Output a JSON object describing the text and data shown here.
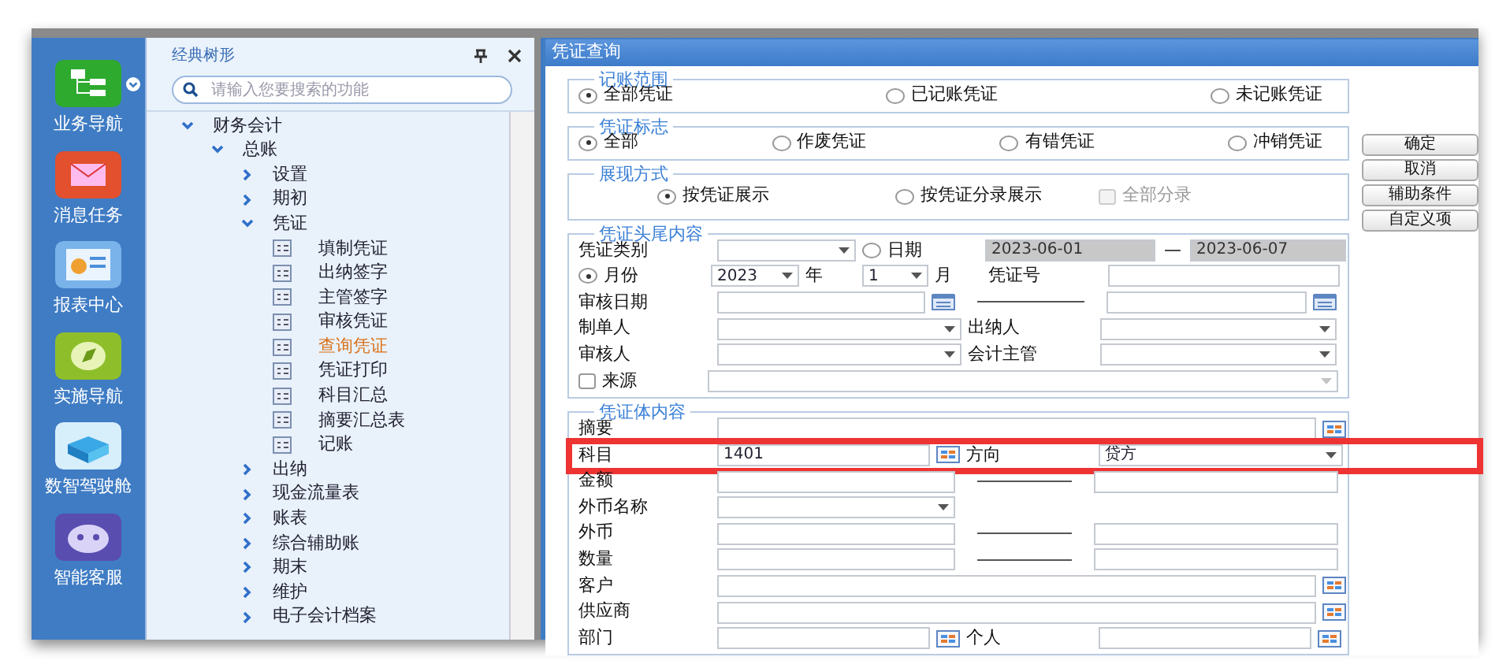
{
  "nav": [
    {
      "label": "业务导航",
      "dropdown": true
    },
    {
      "label": "消息任务",
      "dropdown": false
    },
    {
      "label": "报表中心",
      "dropdown": false
    },
    {
      "label": "实施导航",
      "dropdown": false
    },
    {
      "label": "数智驾驶舱",
      "dropdown": false
    },
    {
      "label": "智能客服",
      "dropdown": false
    }
  ],
  "tree_panel": {
    "title": "经典树形",
    "search": {
      "placeholder": "请输入您要搜索的功能"
    },
    "items": [
      {
        "label": "财务会计",
        "kind": "folder",
        "expanded": true,
        "selected": false,
        "children": [
          {
            "label": "总账",
            "kind": "folder",
            "expanded": true,
            "selected": false,
            "children": [
              {
                "label": "设置",
                "kind": "folder",
                "expanded": false,
                "selected": false
              },
              {
                "label": "期初",
                "kind": "folder",
                "expanded": false,
                "selected": false
              },
              {
                "label": "凭证",
                "kind": "folder",
                "expanded": true,
                "selected": false,
                "children": [
                  {
                    "label": "填制凭证",
                    "kind": "page",
                    "selected": false
                  },
                  {
                    "label": "出纳签字",
                    "kind": "page",
                    "selected": false
                  },
                  {
                    "label": "主管签字",
                    "kind": "page",
                    "selected": false
                  },
                  {
                    "label": "审核凭证",
                    "kind": "page",
                    "selected": false
                  },
                  {
                    "label": "查询凭证",
                    "kind": "page",
                    "selected": true
                  },
                  {
                    "label": "凭证打印",
                    "kind": "page",
                    "selected": false
                  },
                  {
                    "label": "科目汇总",
                    "kind": "page",
                    "selected": false
                  },
                  {
                    "label": "摘要汇总表",
                    "kind": "page",
                    "selected": false
                  },
                  {
                    "label": "记账",
                    "kind": "page",
                    "selected": false
                  }
                ]
              },
              {
                "label": "出纳",
                "kind": "folder",
                "expanded": false,
                "selected": false
              },
              {
                "label": "现金流量表",
                "kind": "folder",
                "expanded": false,
                "selected": false
              },
              {
                "label": "账表",
                "kind": "folder",
                "expanded": false,
                "selected": false
              },
              {
                "label": "综合辅助账",
                "kind": "folder",
                "expanded": false,
                "selected": false
              },
              {
                "label": "期末",
                "kind": "folder",
                "expanded": false,
                "selected": false
              },
              {
                "label": "维护",
                "kind": "folder",
                "expanded": false,
                "selected": false
              },
              {
                "label": "电子会计档案",
                "kind": "folder",
                "expanded": false,
                "selected": false
              }
            ]
          }
        ]
      }
    ]
  },
  "dialog": {
    "title": "凭证查询",
    "radio_groups": [
      {
        "legend": "记账范围",
        "options": [
          {
            "label": "全部凭证",
            "selected": true
          },
          {
            "label": "已记账凭证",
            "selected": false
          },
          {
            "label": "未记账凭证",
            "selected": false
          }
        ]
      },
      {
        "legend": "凭证标志",
        "options": [
          {
            "label": "全部",
            "selected": true
          },
          {
            "label": "作废凭证",
            "selected": false
          },
          {
            "label": "有错凭证",
            "selected": false
          },
          {
            "label": "冲销凭证",
            "selected": false
          }
        ]
      },
      {
        "legend": "展现方式",
        "options": [
          {
            "label": "按凭证展示",
            "selected": true
          },
          {
            "label": "按凭证分录展示",
            "selected": false
          }
        ],
        "checkbox": {
          "label": "全部分录",
          "checked": false,
          "disabled": true
        }
      }
    ],
    "sections": [
      {
        "legend": "凭证头尾内容",
        "rows": [
          {
            "items": [
              {
                "kind": "label",
                "text": "凭证类别"
              },
              {
                "kind": "select",
                "disabled": false
              },
              {
                "kind": "radio",
                "text": "日期",
                "selected": false
              },
              {
                "kind": "input",
                "value": "2023-06-01",
                "disabled": true
              },
              {
                "kind": "dash",
                "text": "—"
              },
              {
                "kind": "input",
                "value": "2023-06-07",
                "disabled": true
              }
            ]
          },
          {
            "items": [
              {
                "kind": "radio",
                "text": "月份",
                "selected": true
              },
              {
                "kind": "select",
                "value": "2023",
                "disabled": false
              },
              {
                "kind": "label",
                "text": "年"
              },
              {
                "kind": "select",
                "value": "1",
                "disabled": false
              },
              {
                "kind": "label",
                "text": "月"
              },
              {
                "kind": "label",
                "text": "凭证号"
              },
              {
                "kind": "input",
                "disabled": false
              }
            ]
          },
          {
            "items": [
              {
                "kind": "label",
                "text": "审核日期"
              },
              {
                "kind": "input",
                "disabled": false
              },
              {
                "kind": "calendar"
              },
              {
                "kind": "rule"
              },
              {
                "kind": "input",
                "disabled": false
              },
              {
                "kind": "calendar"
              }
            ]
          },
          {
            "items": [
              {
                "kind": "label",
                "text": "制单人"
              },
              {
                "kind": "select",
                "disabled": false
              },
              {
                "kind": "label",
                "text": "出纳人"
              },
              {
                "kind": "select",
                "disabled": false
              }
            ]
          },
          {
            "items": [
              {
                "kind": "label",
                "text": "审核人"
              },
              {
                "kind": "select",
                "disabled": false
              },
              {
                "kind": "label",
                "text": "会计主管"
              },
              {
                "kind": "select",
                "disabled": false
              }
            ]
          },
          {
            "items": [
              {
                "kind": "checkbox",
                "text": "来源",
                "checked": false
              },
              {
                "kind": "select",
                "disabled": true
              }
            ]
          }
        ]
      },
      {
        "legend": "凭证体内容",
        "rows": [
          {
            "items": [
              {
                "kind": "label",
                "text": "摘要"
              },
              {
                "kind": "input",
                "disabled": false
              },
              {
                "kind": "picker"
              }
            ]
          },
          {
            "highlight": true,
            "items": [
              {
                "kind": "label",
                "text": "科目"
              },
              {
                "kind": "input",
                "value": "1401",
                "disabled": false
              },
              {
                "kind": "picker"
              },
              {
                "kind": "label",
                "text": "方向"
              },
              {
                "kind": "select",
                "value": "贷方",
                "disabled": false
              }
            ]
          },
          {
            "items": [
              {
                "kind": "label",
                "text": "金额"
              },
              {
                "kind": "input",
                "disabled": false
              },
              {
                "kind": "rule"
              },
              {
                "kind": "input",
                "disabled": false
              }
            ]
          },
          {
            "items": [
              {
                "kind": "label",
                "text": "外币名称"
              },
              {
                "kind": "select",
                "disabled": false
              }
            ]
          },
          {
            "items": [
              {
                "kind": "label",
                "text": "外币"
              },
              {
                "kind": "input",
                "disabled": false
              },
              {
                "kind": "rule"
              },
              {
                "kind": "input",
                "disabled": false
              }
            ]
          },
          {
            "items": [
              {
                "kind": "label",
                "text": "数量"
              },
              {
                "kind": "input",
                "disabled": false
              },
              {
                "kind": "rule"
              },
              {
                "kind": "input",
                "disabled": false
              }
            ]
          },
          {
            "items": [
              {
                "kind": "label",
                "text": "客户"
              },
              {
                "kind": "input",
                "disabled": false
              },
              {
                "kind": "picker"
              }
            ]
          },
          {
            "items": [
              {
                "kind": "label",
                "text": "供应商"
              },
              {
                "kind": "input",
                "disabled": false
              },
              {
                "kind": "picker"
              }
            ]
          },
          {
            "items": [
              {
                "kind": "label",
                "text": "部门"
              },
              {
                "kind": "input",
                "disabled": false
              },
              {
                "kind": "picker"
              },
              {
                "kind": "label",
                "text": "个人"
              },
              {
                "kind": "input",
                "disabled": false
              },
              {
                "kind": "picker"
              }
            ]
          }
        ]
      }
    ],
    "buttons": [
      "确定",
      "取消",
      "辅助条件",
      "自定义项"
    ]
  }
}
